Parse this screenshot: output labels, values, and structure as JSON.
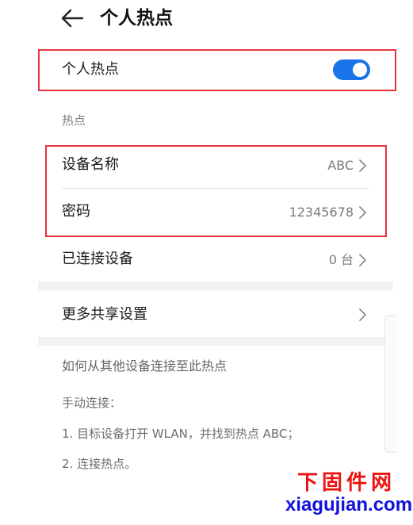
{
  "header": {
    "title": "个人热点"
  },
  "hotspot_toggle": {
    "label": "个人热点",
    "state": "on",
    "color": "#1a73e8"
  },
  "section": {
    "label": "热点"
  },
  "settings": {
    "device_name": {
      "label": "设备名称",
      "value": "ABC"
    },
    "password": {
      "label": "密码",
      "value": "12345678"
    },
    "connected": {
      "label": "已连接设备",
      "value": "0 台"
    },
    "more": {
      "label": "更多共享设置"
    }
  },
  "info": {
    "title": "如何从其他设备连接至此热点",
    "manual": "手动连接：",
    "step1": "1. 目标设备打开 WLAN，并找到热点 ABC；",
    "step2": "2. 连接热点。"
  },
  "watermark": {
    "cn": "下固件网",
    "en": "xiagujian.com"
  },
  "colors": {
    "highlight": "#e8333a",
    "accent": "#1a73e8"
  }
}
